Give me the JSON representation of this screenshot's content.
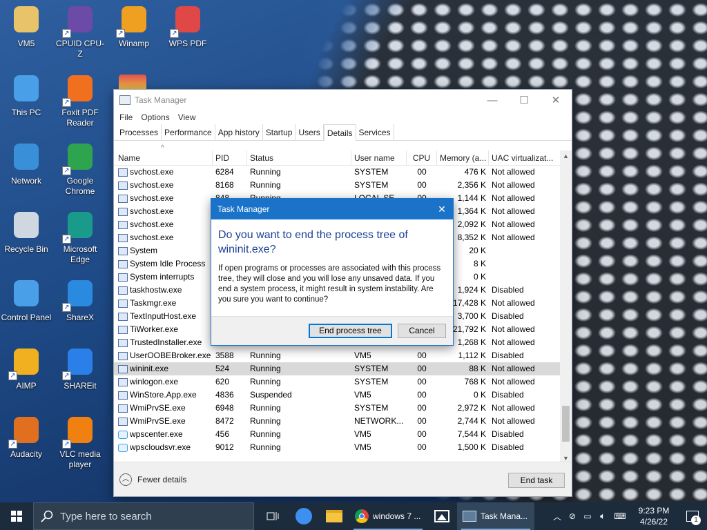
{
  "desktop": {
    "icons": [
      {
        "label": "VM5",
        "icon": "user-folder-icon"
      },
      {
        "label": "CPUID CPU-Z",
        "icon": "cpu-z-icon"
      },
      {
        "label": "Winamp",
        "icon": "winamp-icon"
      },
      {
        "label": "WPS PDF",
        "icon": "wps-pdf-icon"
      },
      {
        "label": "This PC",
        "icon": "computer-icon"
      },
      {
        "label": "Foxit PDF Reader",
        "icon": "foxit-icon"
      },
      {
        "label": "Network",
        "icon": "network-icon"
      },
      {
        "label": "Google Chrome",
        "icon": "chrome-icon"
      },
      {
        "label": "Recycle Bin",
        "icon": "recycle-bin-icon"
      },
      {
        "label": "Microsoft Edge",
        "icon": "edge-icon"
      },
      {
        "label": "Control Panel",
        "icon": "control-panel-icon"
      },
      {
        "label": "ShareX",
        "icon": "sharex-icon"
      },
      {
        "label": "AIMP",
        "icon": "aimp-icon"
      },
      {
        "label": "SHAREit",
        "icon": "shareit-icon"
      },
      {
        "label": "Audacity",
        "icon": "audacity-icon"
      },
      {
        "label": "VLC media player",
        "icon": "vlc-icon"
      }
    ]
  },
  "task_manager": {
    "title": "Task Manager",
    "menu": [
      "File",
      "Options",
      "View"
    ],
    "tabs": [
      "Processes",
      "Performance",
      "App history",
      "Startup",
      "Users",
      "Details",
      "Services"
    ],
    "active_tab": "Details",
    "columns": [
      "Name",
      "PID",
      "Status",
      "User name",
      "CPU",
      "Memory (a...",
      "UAC virtualizat..."
    ],
    "rows": [
      [
        "svchost.exe",
        "6284",
        "Running",
        "SYSTEM",
        "00",
        "476 K",
        "Not allowed"
      ],
      [
        "svchost.exe",
        "8168",
        "Running",
        "SYSTEM",
        "00",
        "2,356 K",
        "Not allowed"
      ],
      [
        "svchost.exe",
        "848",
        "Running",
        "LOCAL SE...",
        "00",
        "1,144 K",
        "Not allowed"
      ],
      [
        "svchost.exe",
        "",
        "",
        "",
        "",
        "1,364 K",
        "Not allowed"
      ],
      [
        "svchost.exe",
        "",
        "",
        "",
        "",
        "2,092 K",
        "Not allowed"
      ],
      [
        "svchost.exe",
        "",
        "",
        "",
        "",
        "8,352 K",
        "Not allowed"
      ],
      [
        "System",
        "",
        "",
        "",
        "",
        "20 K",
        ""
      ],
      [
        "System Idle Process",
        "",
        "",
        "",
        "",
        "8 K",
        ""
      ],
      [
        "System interrupts",
        "",
        "",
        "",
        "",
        "0 K",
        ""
      ],
      [
        "taskhostw.exe",
        "",
        "",
        "",
        "",
        "1,924 K",
        "Disabled"
      ],
      [
        "Taskmgr.exe",
        "",
        "",
        "",
        "",
        "17,428 K",
        "Not allowed"
      ],
      [
        "TextInputHost.exe",
        "",
        "",
        "",
        "",
        "3,700 K",
        "Disabled"
      ],
      [
        "TiWorker.exe",
        "",
        "",
        "",
        "",
        "21,792 K",
        "Not allowed"
      ],
      [
        "TrustedInstaller.exe",
        "",
        "",
        "",
        "",
        "1,268 K",
        "Not allowed"
      ],
      [
        "UserOOBEBroker.exe",
        "3588",
        "Running",
        "VM5",
        "00",
        "1,112 K",
        "Disabled"
      ],
      [
        "wininit.exe",
        "524",
        "Running",
        "SYSTEM",
        "00",
        "88 K",
        "Not allowed"
      ],
      [
        "winlogon.exe",
        "620",
        "Running",
        "SYSTEM",
        "00",
        "768 K",
        "Not allowed"
      ],
      [
        "WinStore.App.exe",
        "4836",
        "Suspended",
        "VM5",
        "00",
        "0 K",
        "Disabled"
      ],
      [
        "WmiPrvSE.exe",
        "6948",
        "Running",
        "SYSTEM",
        "00",
        "2,972 K",
        "Not allowed"
      ],
      [
        "WmiPrvSE.exe",
        "8472",
        "Running",
        "NETWORK...",
        "00",
        "2,744 K",
        "Not allowed"
      ],
      [
        "wpscenter.exe",
        "456",
        "Running",
        "VM5",
        "00",
        "7,544 K",
        "Disabled"
      ],
      [
        "wpscloudsvr.exe",
        "9012",
        "Running",
        "VM5",
        "00",
        "1,500 K",
        "Disabled"
      ]
    ],
    "selected_row": 15,
    "fewer_details": "Fewer details",
    "end_task": "End task"
  },
  "dialog": {
    "title": "Task Manager",
    "question": "Do you want to end the process tree of wininit.exe?",
    "message": "If open programs or processes are associated with this process tree, they will close and you will lose any unsaved data. If you end a system process, it might result in system instability. Are you sure you want to continue?",
    "confirm": "End process tree",
    "cancel": "Cancel"
  },
  "taskbar": {
    "search_placeholder": "Type here to search",
    "chrome_label": "windows 7 ...",
    "taskmgr_label": "Task Mana...",
    "time": "9:23 PM",
    "date": "4/26/22",
    "notifications": "1"
  }
}
